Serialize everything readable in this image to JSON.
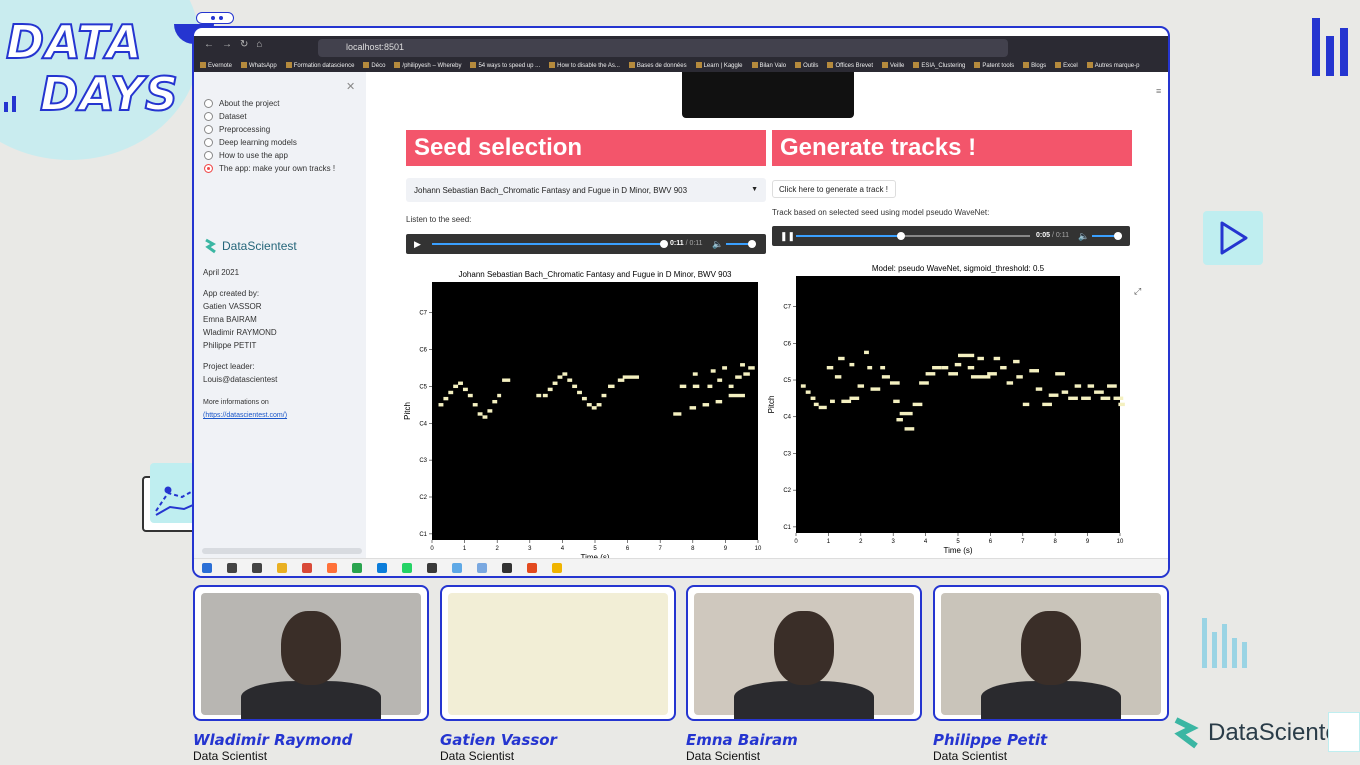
{
  "branding": {
    "event_title_line1": "DATA",
    "event_title_line2": "DAYS",
    "footer_logo": "DataScientest",
    "colors": {
      "primary": "#2535d0",
      "accent_light": "#c9ecef",
      "highlight": "#f3556b"
    }
  },
  "browser": {
    "url": "localhost:8501",
    "bookmarks": [
      "Evernote",
      "WhatsApp",
      "Formation datascience",
      "Déco",
      "/philipyesh – Whereby",
      "54 ways to speed up ...",
      "How to disable the As...",
      "Bases de données",
      "Learn | Kaggle",
      "Bilan Valo",
      "Outils",
      "Offices Brevet",
      "Veille",
      "ESIA_Clustering",
      "Patent tools",
      "Blogs",
      "Excel",
      "Autres marque-p"
    ]
  },
  "sidebar": {
    "nav": [
      {
        "label": "About the project",
        "selected": false
      },
      {
        "label": "Dataset",
        "selected": false
      },
      {
        "label": "Preprocessing",
        "selected": false
      },
      {
        "label": "Deep learning models",
        "selected": false
      },
      {
        "label": "How to use the app",
        "selected": false
      },
      {
        "label": "The app: make your own tracks !",
        "selected": true
      }
    ],
    "brand": "DataScientest",
    "date": "April 2021",
    "created_by_label": "App created by:",
    "authors": [
      "Gatien VASSOR",
      "Emna BAIRAM",
      "Wladimir RAYMOND",
      "Philippe PETIT"
    ],
    "leader_label": "Project leader:",
    "leader_email": "Louis@datascientest",
    "more_info_label": "More informations on",
    "more_info_link": "(https://datascientest.com/)"
  },
  "seed": {
    "heading": "Seed selection",
    "selected": "Johann Sebastian Bach_Chromatic Fantasy and Fugue in D Minor, BWV 903",
    "listen_label": "Listen to the seed:",
    "player": {
      "current": "0:11",
      "duration": "0:11",
      "progress": 1.0,
      "volume": 0.85
    }
  },
  "generate": {
    "heading": "Generate tracks !",
    "button_label": "Click here to generate a track !",
    "caption": "Track based on selected seed using model pseudo WaveNet:",
    "player": {
      "current": "0:05",
      "duration": "0:11",
      "progress": 0.45,
      "volume": 0.85
    }
  },
  "chart_data": [
    {
      "type": "scatter",
      "title": "Johann Sebastian Bach_Chromatic Fantasy and Fugue in D Minor, BWV 903",
      "xlabel": "Time (s)",
      "ylabel": "Pitch",
      "xlim": [
        0,
        10
      ],
      "ylim": [
        22,
        106
      ],
      "xticks": [
        0,
        1,
        2,
        3,
        4,
        5,
        6,
        7,
        8,
        9,
        10
      ],
      "yticks": [
        {
          "v": 24,
          "label": "C1"
        },
        {
          "v": 36,
          "label": "C2"
        },
        {
          "v": 48,
          "label": "C3"
        },
        {
          "v": 60,
          "label": "C4"
        },
        {
          "v": 72,
          "label": "C5"
        },
        {
          "v": 84,
          "label": "C6"
        },
        {
          "v": 96,
          "label": "C7"
        }
      ],
      "background": "#000000",
      "note_color": "#f4f0c0",
      "notes": [
        {
          "t": 0.2,
          "p": 66,
          "d": 0.15
        },
        {
          "t": 0.35,
          "p": 68,
          "d": 0.15
        },
        {
          "t": 0.5,
          "p": 70,
          "d": 0.15
        },
        {
          "t": 0.65,
          "p": 72,
          "d": 0.15
        },
        {
          "t": 0.8,
          "p": 73,
          "d": 0.15
        },
        {
          "t": 0.95,
          "p": 71,
          "d": 0.15
        },
        {
          "t": 1.1,
          "p": 69,
          "d": 0.15
        },
        {
          "t": 1.25,
          "p": 66,
          "d": 0.15
        },
        {
          "t": 1.4,
          "p": 63,
          "d": 0.15
        },
        {
          "t": 1.55,
          "p": 62,
          "d": 0.15
        },
        {
          "t": 1.7,
          "p": 64,
          "d": 0.15
        },
        {
          "t": 1.85,
          "p": 67,
          "d": 0.15
        },
        {
          "t": 2.0,
          "p": 69,
          "d": 0.12
        },
        {
          "t": 2.15,
          "p": 74,
          "d": 0.25
        },
        {
          "t": 3.2,
          "p": 69,
          "d": 0.15
        },
        {
          "t": 3.4,
          "p": 69,
          "d": 0.15
        },
        {
          "t": 3.55,
          "p": 71,
          "d": 0.15
        },
        {
          "t": 3.7,
          "p": 73,
          "d": 0.15
        },
        {
          "t": 3.85,
          "p": 75,
          "d": 0.15
        },
        {
          "t": 4.0,
          "p": 76,
          "d": 0.15
        },
        {
          "t": 4.15,
          "p": 74,
          "d": 0.15
        },
        {
          "t": 4.3,
          "p": 72,
          "d": 0.15
        },
        {
          "t": 4.45,
          "p": 70,
          "d": 0.15
        },
        {
          "t": 4.6,
          "p": 68,
          "d": 0.15
        },
        {
          "t": 4.75,
          "p": 66,
          "d": 0.15
        },
        {
          "t": 4.9,
          "p": 65,
          "d": 0.15
        },
        {
          "t": 5.05,
          "p": 66,
          "d": 0.15
        },
        {
          "t": 5.2,
          "p": 69,
          "d": 0.15
        },
        {
          "t": 5.4,
          "p": 72,
          "d": 0.2
        },
        {
          "t": 5.7,
          "p": 74,
          "d": 0.2
        },
        {
          "t": 5.85,
          "p": 75,
          "d": 0.5
        },
        {
          "t": 7.4,
          "p": 63,
          "d": 0.25
        },
        {
          "t": 7.6,
          "p": 72,
          "d": 0.2
        },
        {
          "t": 7.9,
          "p": 65,
          "d": 0.2
        },
        {
          "t": 8.0,
          "p": 72,
          "d": 0.2
        },
        {
          "t": 8.0,
          "p": 76,
          "d": 0.15
        },
        {
          "t": 8.3,
          "p": 66,
          "d": 0.2
        },
        {
          "t": 8.45,
          "p": 72,
          "d": 0.15
        },
        {
          "t": 8.55,
          "p": 77,
          "d": 0.15
        },
        {
          "t": 8.7,
          "p": 67,
          "d": 0.2
        },
        {
          "t": 8.75,
          "p": 74,
          "d": 0.15
        },
        {
          "t": 8.9,
          "p": 78,
          "d": 0.15
        },
        {
          "t": 9.1,
          "p": 72,
          "d": 0.15
        },
        {
          "t": 9.1,
          "p": 69,
          "d": 0.5
        },
        {
          "t": 9.3,
          "p": 75,
          "d": 0.2
        },
        {
          "t": 9.45,
          "p": 79,
          "d": 0.15
        },
        {
          "t": 9.55,
          "p": 76,
          "d": 0.2
        },
        {
          "t": 9.7,
          "p": 78,
          "d": 0.2
        }
      ]
    },
    {
      "type": "scatter",
      "title": "Model: pseudo WaveNet, sigmoid_threshold: 0.5",
      "xlabel": "Time (s)",
      "ylabel": "Pitch",
      "xlim": [
        0,
        10
      ],
      "ylim": [
        22,
        106
      ],
      "xticks": [
        0,
        1,
        2,
        3,
        4,
        5,
        6,
        7,
        8,
        9,
        10
      ],
      "yticks": [
        {
          "v": 24,
          "label": "C1"
        },
        {
          "v": 36,
          "label": "C2"
        },
        {
          "v": 48,
          "label": "C3"
        },
        {
          "v": 60,
          "label": "C4"
        },
        {
          "v": 72,
          "label": "C5"
        },
        {
          "v": 84,
          "label": "C6"
        },
        {
          "v": 96,
          "label": "C7"
        }
      ],
      "background": "#000000",
      "note_color": "#f4f0c0",
      "notes": [
        {
          "t": 0.15,
          "p": 70,
          "d": 0.15
        },
        {
          "t": 0.3,
          "p": 68,
          "d": 0.15
        },
        {
          "t": 0.45,
          "p": 66,
          "d": 0.15
        },
        {
          "t": 0.55,
          "p": 64,
          "d": 0.15
        },
        {
          "t": 0.7,
          "p": 63,
          "d": 0.25
        },
        {
          "t": 0.95,
          "p": 76,
          "d": 0.2
        },
        {
          "t": 1.05,
          "p": 65,
          "d": 0.15
        },
        {
          "t": 1.2,
          "p": 73,
          "d": 0.2
        },
        {
          "t": 1.3,
          "p": 79,
          "d": 0.2
        },
        {
          "t": 1.4,
          "p": 65,
          "d": 0.3
        },
        {
          "t": 1.65,
          "p": 77,
          "d": 0.15
        },
        {
          "t": 1.65,
          "p": 66,
          "d": 0.3
        },
        {
          "t": 1.9,
          "p": 70,
          "d": 0.2
        },
        {
          "t": 2.1,
          "p": 81,
          "d": 0.15
        },
        {
          "t": 2.2,
          "p": 76,
          "d": 0.15
        },
        {
          "t": 2.3,
          "p": 69,
          "d": 0.3
        },
        {
          "t": 2.6,
          "p": 76,
          "d": 0.15
        },
        {
          "t": 2.65,
          "p": 73,
          "d": 0.25
        },
        {
          "t": 2.9,
          "p": 71,
          "d": 0.3
        },
        {
          "t": 3.0,
          "p": 65,
          "d": 0.2
        },
        {
          "t": 3.1,
          "p": 59,
          "d": 0.2
        },
        {
          "t": 3.2,
          "p": 61,
          "d": 0.4
        },
        {
          "t": 3.35,
          "p": 56,
          "d": 0.3
        },
        {
          "t": 3.6,
          "p": 64,
          "d": 0.3
        },
        {
          "t": 3.8,
          "p": 71,
          "d": 0.3
        },
        {
          "t": 4.0,
          "p": 74,
          "d": 0.3
        },
        {
          "t": 4.2,
          "p": 76,
          "d": 0.3
        },
        {
          "t": 4.5,
          "p": 76,
          "d": 0.2
        },
        {
          "t": 4.7,
          "p": 74,
          "d": 0.3
        },
        {
          "t": 4.9,
          "p": 77,
          "d": 0.2
        },
        {
          "t": 5.0,
          "p": 80,
          "d": 0.5
        },
        {
          "t": 5.3,
          "p": 76,
          "d": 0.2
        },
        {
          "t": 5.4,
          "p": 73,
          "d": 0.6
        },
        {
          "t": 5.6,
          "p": 79,
          "d": 0.2
        },
        {
          "t": 5.9,
          "p": 74,
          "d": 0.3
        },
        {
          "t": 6.1,
          "p": 79,
          "d": 0.2
        },
        {
          "t": 6.3,
          "p": 76,
          "d": 0.2
        },
        {
          "t": 6.5,
          "p": 71,
          "d": 0.2
        },
        {
          "t": 6.7,
          "p": 78,
          "d": 0.2
        },
        {
          "t": 6.8,
          "p": 73,
          "d": 0.2
        },
        {
          "t": 7.0,
          "p": 64,
          "d": 0.2
        },
        {
          "t": 7.2,
          "p": 75,
          "d": 0.3
        },
        {
          "t": 7.4,
          "p": 69,
          "d": 0.2
        },
        {
          "t": 7.6,
          "p": 64,
          "d": 0.3
        },
        {
          "t": 7.8,
          "p": 67,
          "d": 0.3
        },
        {
          "t": 8.0,
          "p": 74,
          "d": 0.3
        },
        {
          "t": 8.2,
          "p": 68,
          "d": 0.2
        },
        {
          "t": 8.4,
          "p": 66,
          "d": 0.3
        },
        {
          "t": 8.6,
          "p": 70,
          "d": 0.2
        },
        {
          "t": 8.8,
          "p": 66,
          "d": 0.3
        },
        {
          "t": 9.0,
          "p": 70,
          "d": 0.2
        },
        {
          "t": 9.2,
          "p": 68,
          "d": 0.3
        },
        {
          "t": 9.4,
          "p": 66,
          "d": 0.3
        },
        {
          "t": 9.6,
          "p": 70,
          "d": 0.3
        },
        {
          "t": 9.8,
          "p": 66,
          "d": 0.3
        },
        {
          "t": 9.95,
          "p": 64,
          "d": 0.2
        }
      ]
    }
  ],
  "participants": [
    {
      "name": "Wladimir Raymond",
      "role": "Data Scientist",
      "video_bg": "#b8b6b2"
    },
    {
      "name": "Gatien Vassor",
      "role": "Data Scientist",
      "video_bg": "#f2eed6"
    },
    {
      "name": "Emna Bairam",
      "role": "Data Scientist",
      "video_bg": "#cfc8be"
    },
    {
      "name": "Philippe Petit",
      "role": "Data Scientist",
      "video_bg": "#c9c4ba"
    }
  ]
}
